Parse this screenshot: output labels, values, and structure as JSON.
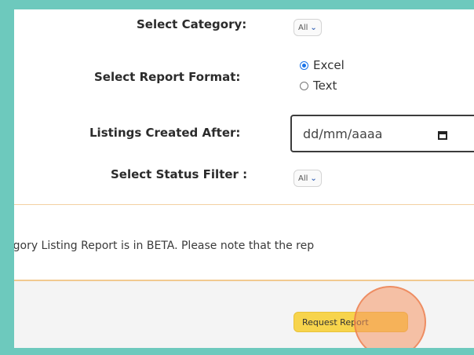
{
  "form": {
    "category": {
      "label": "Select Category:",
      "value": "All"
    },
    "report_format": {
      "label": "Select Report Format:",
      "options": [
        "Excel",
        "Text"
      ],
      "selected": "Excel"
    },
    "listings_created_after": {
      "label": "Listings Created After:",
      "placeholder": "dd/mm/aaaa"
    },
    "status_filter": {
      "label": "Select Status Filter :",
      "value": "All"
    }
  },
  "notice": {
    "text": "egory Listing Report is in BETA. Please note that the rep"
  },
  "actions": {
    "request_report_label": "Request Report"
  },
  "colors": {
    "frame": "#6dc9bd",
    "button": "#f7d44c",
    "notice_border": "#f1c98f",
    "radio_accent": "#1a73e8"
  }
}
